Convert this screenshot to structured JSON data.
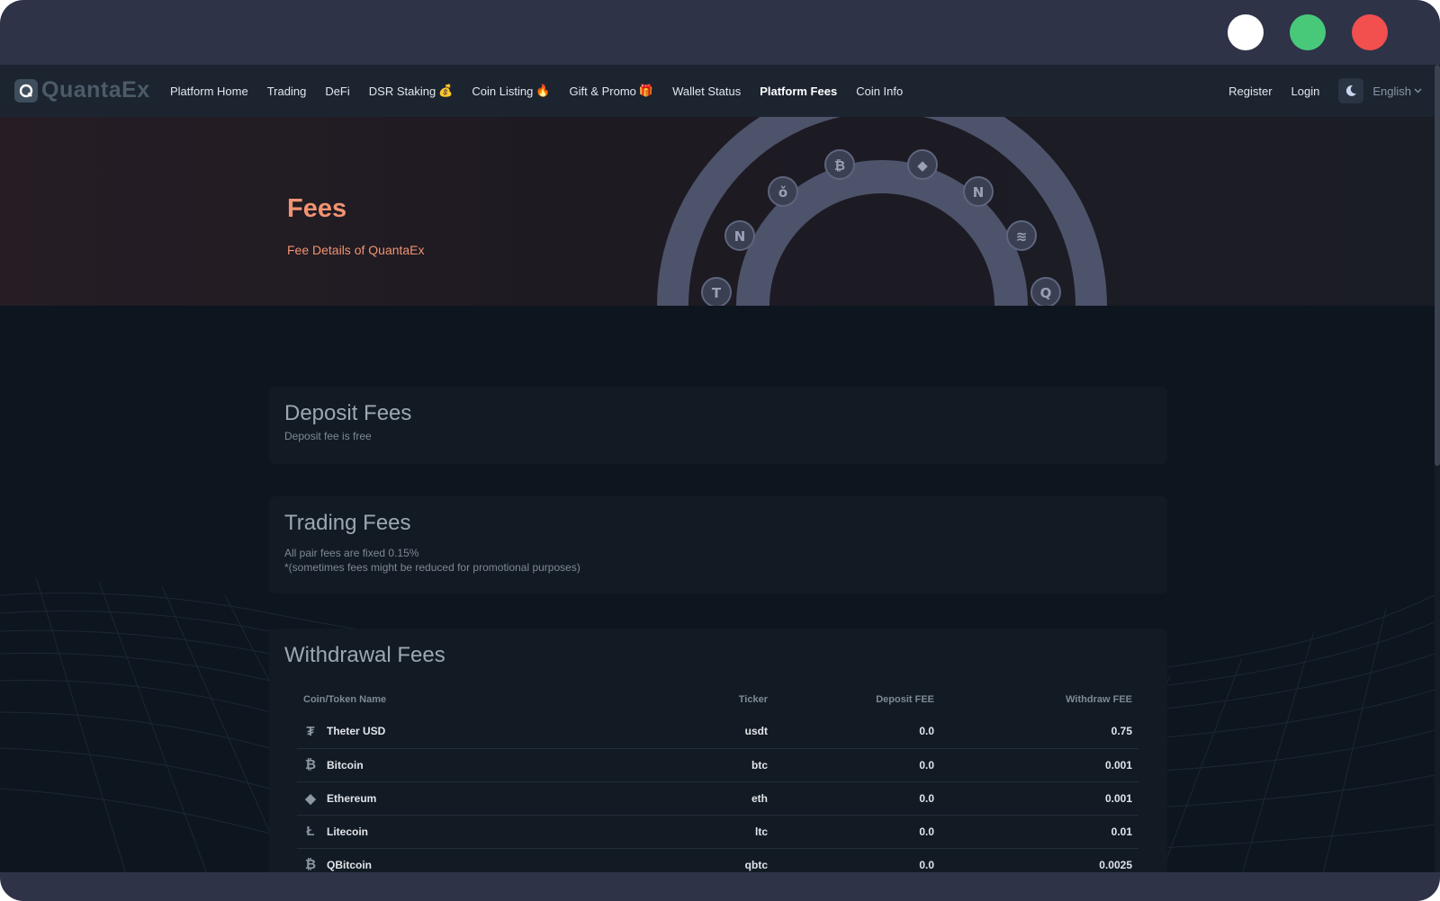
{
  "window": {
    "buttons": [
      "minimize",
      "maximize",
      "close"
    ]
  },
  "brand": {
    "name": "QuantaEx"
  },
  "nav": {
    "links": [
      {
        "label": "Platform Home",
        "emoji": ""
      },
      {
        "label": "Trading",
        "emoji": ""
      },
      {
        "label": "DeFi",
        "emoji": ""
      },
      {
        "label": "DSR Staking",
        "emoji": "💰"
      },
      {
        "label": "Coin Listing",
        "emoji": "🔥"
      },
      {
        "label": "Gift & Promo",
        "emoji": "🎁"
      },
      {
        "label": "Wallet Status",
        "emoji": ""
      },
      {
        "label": "Platform Fees",
        "emoji": "",
        "active": true
      },
      {
        "label": "Coin Info",
        "emoji": ""
      }
    ],
    "register": "Register",
    "login": "Login",
    "language": "English"
  },
  "hero": {
    "title": "Fees",
    "subtitle": "Fee Details of QuantaEx"
  },
  "deposit": {
    "title": "Deposit Fees",
    "text": "Deposit fee is free"
  },
  "trading": {
    "title": "Trading Fees",
    "line1": "All pair fees are fixed 0.15%",
    "line2": "*(sometimes fees might be reduced for promotional purposes)"
  },
  "withdrawal": {
    "title": "Withdrawal Fees",
    "headers": {
      "name": "Coin/Token Name",
      "ticker": "Ticker",
      "deposit": "Deposit FEE",
      "withdraw": "Withdraw FEE"
    },
    "rows": [
      {
        "icon": "tether-icon",
        "name": "Theter USD",
        "ticker": "usdt",
        "deposit": "0.0",
        "withdraw": "0.75"
      },
      {
        "icon": "bitcoin-icon",
        "name": "Bitcoin",
        "ticker": "btc",
        "deposit": "0.0",
        "withdraw": "0.001"
      },
      {
        "icon": "ethereum-icon",
        "name": "Ethereum",
        "ticker": "eth",
        "deposit": "0.0",
        "withdraw": "0.001"
      },
      {
        "icon": "litecoin-icon",
        "name": "Litecoin",
        "ticker": "ltc",
        "deposit": "0.0",
        "withdraw": "0.01"
      },
      {
        "icon": "qbitcoin-icon",
        "name": "QBitcoin",
        "ticker": "qbtc",
        "deposit": "0.0",
        "withdraw": "0.0025"
      }
    ]
  },
  "colors": {
    "accent": "#f19372",
    "chrome": "#2e3348",
    "navbar": "#1c2430",
    "page": "#0d151e",
    "card": "#121a23"
  }
}
